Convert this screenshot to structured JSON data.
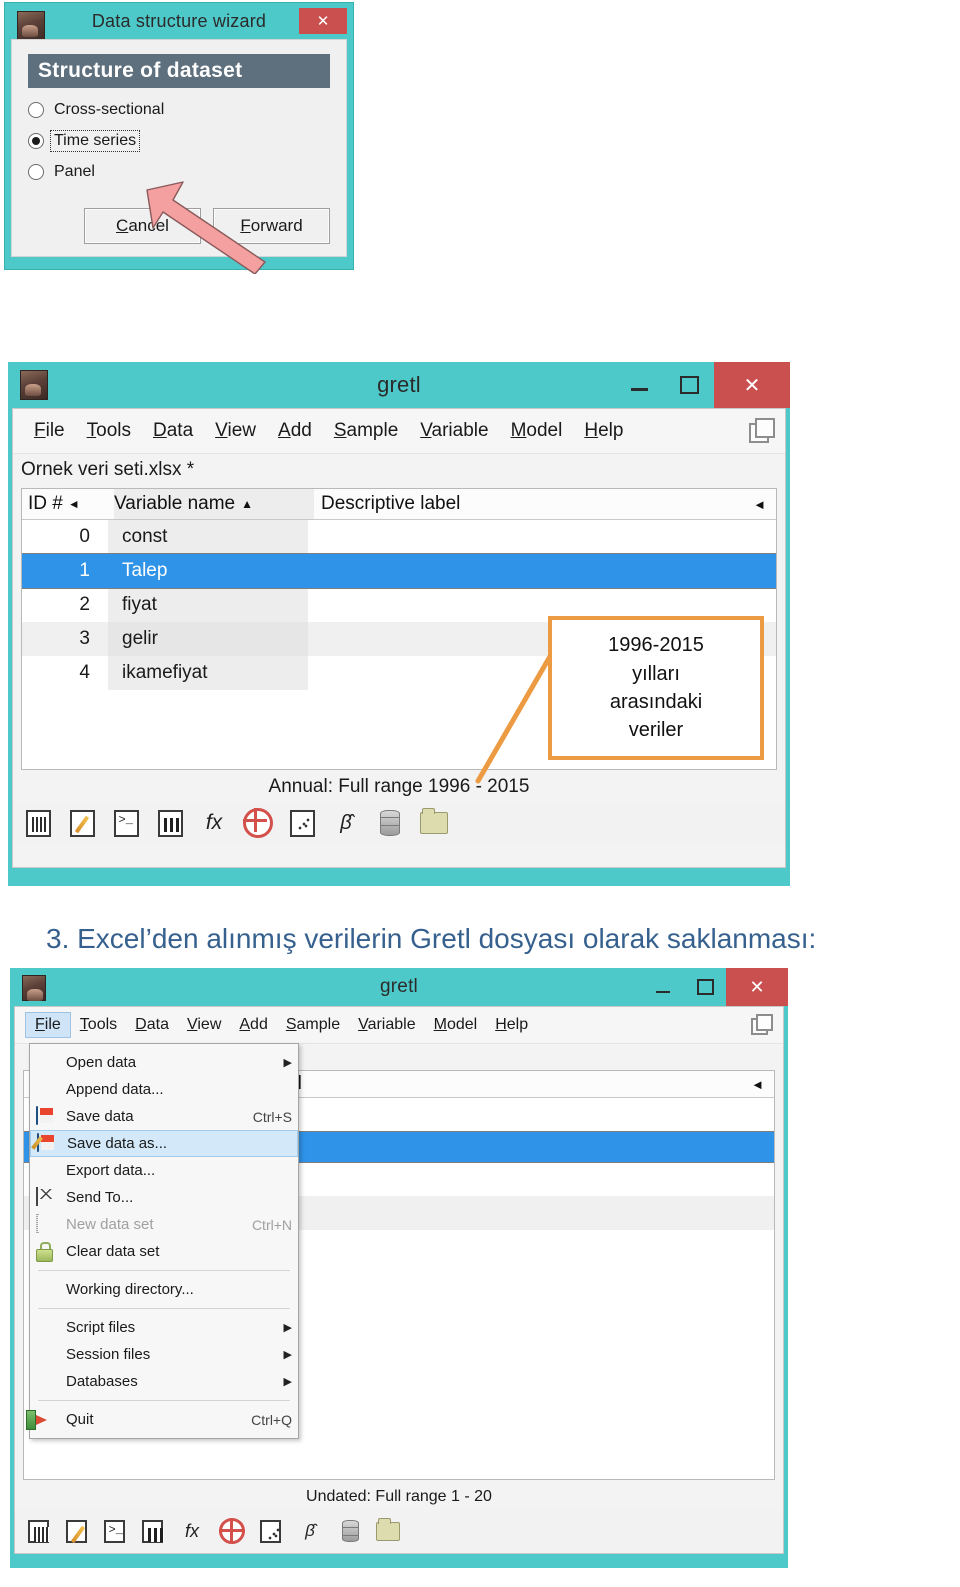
{
  "wizard": {
    "title": "Data structure wizard",
    "close_label": "✕",
    "banner": "Structure of dataset",
    "options": [
      {
        "label": "Cross-sectional",
        "selected": false,
        "focused": false
      },
      {
        "label": "Time series",
        "selected": true,
        "focused": true
      },
      {
        "label": "Panel",
        "selected": false,
        "focused": false
      }
    ],
    "buttons": [
      {
        "accel": "C",
        "rest": "ancel",
        "name": "cancel-button"
      },
      {
        "accel": "F",
        "rest": "orward",
        "name": "forward-button"
      }
    ]
  },
  "gretl_main": {
    "title": "gretl",
    "minimize_label": "–",
    "maximize_label": "□",
    "close_label": "✕",
    "menus": [
      {
        "accel": "F",
        "rest": "ile"
      },
      {
        "accel": "T",
        "rest": "ools"
      },
      {
        "accel": "D",
        "rest": "ata"
      },
      {
        "accel": "V",
        "rest": "iew"
      },
      {
        "accel": "A",
        "rest": "dd"
      },
      {
        "accel": "S",
        "rest": "ample"
      },
      {
        "accel": "V",
        "rest": "ariable"
      },
      {
        "accel": "M",
        "rest": "odel"
      },
      {
        "accel": "H",
        "rest": "elp"
      }
    ],
    "filename": "Ornek veri seti.xlsx *",
    "columns": {
      "id": "ID #",
      "name": "Variable name",
      "label": "Descriptive label"
    },
    "sort_glyph": "▲",
    "left_glyph": "◄",
    "rows": [
      {
        "id": "0",
        "name": "const",
        "label": "",
        "selected": false
      },
      {
        "id": "1",
        "name": "Talep",
        "label": "",
        "selected": true
      },
      {
        "id": "2",
        "name": "fiyat",
        "label": "",
        "selected": false
      },
      {
        "id": "3",
        "name": "gelir",
        "label": "",
        "selected": false
      },
      {
        "id": "4",
        "name": "ikamefiyat",
        "label": "",
        "selected": false
      }
    ],
    "status": "Annual: Full range 1996 - 2015",
    "toolbar": [
      {
        "name": "calculator-icon",
        "glyph": ""
      },
      {
        "name": "edit-script-icon",
        "glyph": ""
      },
      {
        "name": "console-icon",
        "glyph": ""
      },
      {
        "name": "icon-view-icon",
        "glyph": ""
      },
      {
        "name": "function-fx-icon",
        "glyph": "fx"
      },
      {
        "name": "help-lifebuoy-icon",
        "glyph": ""
      },
      {
        "name": "scatter-plot-icon",
        "glyph": ""
      },
      {
        "name": "model-beta-icon",
        "glyph": "β̂"
      },
      {
        "name": "database-icon",
        "glyph": ""
      },
      {
        "name": "open-folder-icon",
        "glyph": ""
      }
    ]
  },
  "callout": {
    "lines": [
      "1996-2015",
      "yılları",
      "arasındaki",
      "veriler"
    ],
    "border_color": "#ed9b42"
  },
  "heading": "3. Excel’den alınmış verilerin Gretl dosyası olarak saklanması:",
  "gretl_menu_window": {
    "title": "gretl",
    "minimize_label": "–",
    "maximize_label": "□",
    "close_label": "✕",
    "menus": [
      {
        "accel": "F",
        "rest": "ile",
        "active": true
      },
      {
        "accel": "T",
        "rest": "ools",
        "active": false
      },
      {
        "accel": "D",
        "rest": "ata",
        "active": false
      },
      {
        "accel": "V",
        "rest": "iew",
        "active": false
      },
      {
        "accel": "A",
        "rest": "dd",
        "active": false
      },
      {
        "accel": "S",
        "rest": "ample",
        "active": false
      },
      {
        "accel": "V",
        "rest": "ariable",
        "active": false
      },
      {
        "accel": "M",
        "rest": "odel",
        "active": false
      },
      {
        "accel": "H",
        "rest": "elp",
        "active": false
      }
    ],
    "partial_column_label": "el",
    "left_glyph": "◄",
    "submenu_glyph": "▶",
    "file_menu": [
      {
        "icon": "none",
        "accel": "O",
        "rest": "pen data",
        "accel_pos": "start",
        "label": "Open data",
        "shortcut": "",
        "submenu": true,
        "highlighted": false,
        "disabled": false
      },
      {
        "icon": "none",
        "label": "Append data...",
        "shortcut": "",
        "submenu": false,
        "highlighted": false,
        "disabled": false
      },
      {
        "icon": "floppy",
        "label": "Save data",
        "shortcut": "Ctrl+S",
        "submenu": false,
        "highlighted": false,
        "disabled": false
      },
      {
        "icon": "floppy-pen",
        "label": "Save data as...",
        "shortcut": "",
        "submenu": false,
        "highlighted": true,
        "disabled": false
      },
      {
        "icon": "none",
        "label": "Export data...",
        "shortcut": "",
        "submenu": false,
        "highlighted": false,
        "disabled": false
      },
      {
        "icon": "envelope",
        "label": "Send To...",
        "shortcut": "",
        "submenu": false,
        "highlighted": false,
        "disabled": false
      },
      {
        "icon": "page",
        "label": "New data set",
        "shortcut": "Ctrl+N",
        "submenu": false,
        "highlighted": false,
        "disabled": true
      },
      {
        "icon": "lock",
        "label": "Clear data set",
        "shortcut": "",
        "submenu": false,
        "highlighted": false,
        "disabled": false
      },
      {
        "icon": "sep",
        "label": "",
        "shortcut": "",
        "submenu": false,
        "highlighted": false,
        "disabled": false
      },
      {
        "icon": "none",
        "label": "Working directory...",
        "shortcut": "",
        "submenu": false,
        "highlighted": false,
        "disabled": false
      },
      {
        "icon": "sep",
        "label": "",
        "shortcut": "",
        "submenu": false,
        "highlighted": false,
        "disabled": false
      },
      {
        "icon": "none",
        "label": "Script files",
        "shortcut": "",
        "submenu": true,
        "highlighted": false,
        "disabled": false
      },
      {
        "icon": "none",
        "label": "Session files",
        "shortcut": "",
        "submenu": true,
        "highlighted": false,
        "disabled": false
      },
      {
        "icon": "none",
        "label": "Databases",
        "shortcut": "",
        "submenu": true,
        "highlighted": false,
        "disabled": false
      },
      {
        "icon": "sep",
        "label": "",
        "shortcut": "",
        "submenu": false,
        "highlighted": false,
        "disabled": false
      },
      {
        "icon": "quit",
        "label": "Quit",
        "shortcut": "Ctrl+Q",
        "submenu": false,
        "highlighted": false,
        "disabled": false
      }
    ],
    "status": "Undated: Full range 1 - 20",
    "toolbar": [
      {
        "name": "calculator-icon"
      },
      {
        "name": "edit-script-icon"
      },
      {
        "name": "console-icon"
      },
      {
        "name": "icon-view-icon"
      },
      {
        "name": "function-fx-icon"
      },
      {
        "name": "help-lifebuoy-icon"
      },
      {
        "name": "scatter-plot-icon"
      },
      {
        "name": "model-beta-icon"
      },
      {
        "name": "database-icon"
      },
      {
        "name": "open-folder-icon"
      }
    ]
  },
  "colors": {
    "window_frame_teal": "#4ec9c9",
    "close_red": "#c9504f",
    "selection_blue": "#2f93e8",
    "banner_slate": "#5e6f7d",
    "callout_orange": "#ed9b42",
    "heading_blue": "#36618e",
    "arrow_pink": "#f4a0a0"
  }
}
